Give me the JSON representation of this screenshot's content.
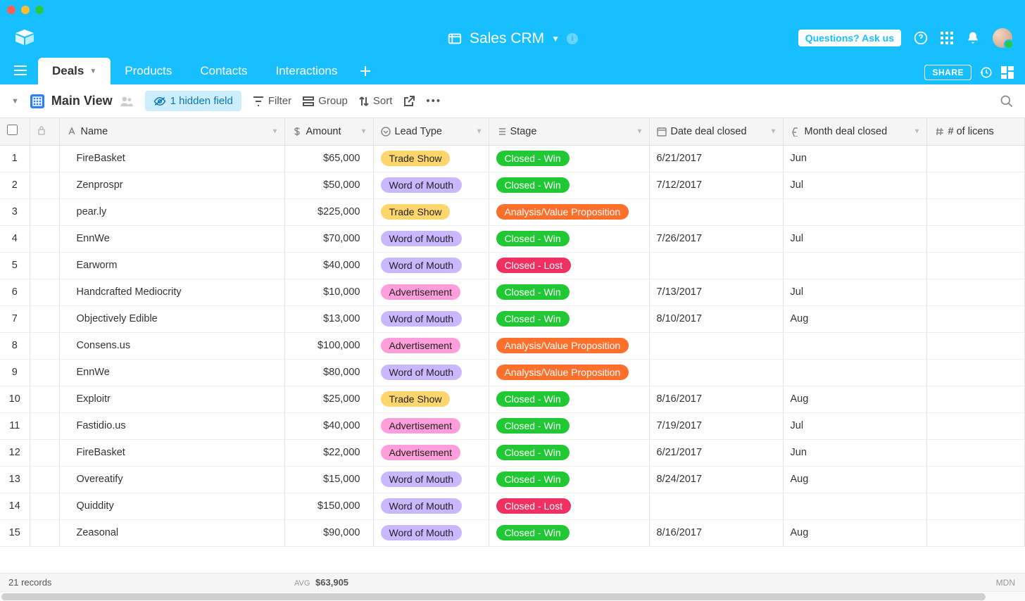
{
  "window": {
    "title": "Sales CRM"
  },
  "topbar": {
    "ask_button": "Questions? Ask us"
  },
  "tabs": [
    {
      "label": "Deals",
      "active": true
    },
    {
      "label": "Products",
      "active": false
    },
    {
      "label": "Contacts",
      "active": false
    },
    {
      "label": "Interactions",
      "active": false
    }
  ],
  "share_label": "SHARE",
  "viewbar": {
    "view_name": "Main View",
    "hidden_fields": "1 hidden field",
    "filter": "Filter",
    "group": "Group",
    "sort": "Sort"
  },
  "columns": [
    {
      "key": "name",
      "label": "Name",
      "icon": "text"
    },
    {
      "key": "amount",
      "label": "Amount",
      "icon": "currency"
    },
    {
      "key": "lead_type",
      "label": "Lead Type",
      "icon": "select"
    },
    {
      "key": "stage",
      "label": "Stage",
      "icon": "list"
    },
    {
      "key": "date_closed",
      "label": "Date deal closed",
      "icon": "date"
    },
    {
      "key": "month_closed",
      "label": "Month deal closed",
      "icon": "formula"
    },
    {
      "key": "licenses",
      "label": "# of licens",
      "icon": "number"
    }
  ],
  "lead_type_colors": {
    "Trade Show": "pill-trade-show",
    "Word of Mouth": "pill-word-of-mouth",
    "Advertisement": "pill-advertisement"
  },
  "stage_colors": {
    "Closed - Win": "pill-closed-win",
    "Closed - Lost": "pill-closed-lost",
    "Analysis/Value Proposition": "pill-analysis"
  },
  "rows": [
    {
      "name": "FireBasket",
      "amount": "$65,000",
      "lead_type": "Trade Show",
      "stage": "Closed - Win",
      "date_closed": "6/21/2017",
      "month_closed": "Jun"
    },
    {
      "name": "Zenprospr",
      "amount": "$50,000",
      "lead_type": "Word of Mouth",
      "stage": "Closed - Win",
      "date_closed": "7/12/2017",
      "month_closed": "Jul"
    },
    {
      "name": "pear.ly",
      "amount": "$225,000",
      "lead_type": "Trade Show",
      "stage": "Analysis/Value Proposition",
      "date_closed": "",
      "month_closed": ""
    },
    {
      "name": "EnnWe",
      "amount": "$70,000",
      "lead_type": "Word of Mouth",
      "stage": "Closed - Win",
      "date_closed": "7/26/2017",
      "month_closed": "Jul"
    },
    {
      "name": "Earworm",
      "amount": "$40,000",
      "lead_type": "Word of Mouth",
      "stage": "Closed - Lost",
      "date_closed": "",
      "month_closed": ""
    },
    {
      "name": "Handcrafted Mediocrity",
      "amount": "$10,000",
      "lead_type": "Advertisement",
      "stage": "Closed - Win",
      "date_closed": "7/13/2017",
      "month_closed": "Jul"
    },
    {
      "name": "Objectively Edible",
      "amount": "$13,000",
      "lead_type": "Word of Mouth",
      "stage": "Closed - Win",
      "date_closed": "8/10/2017",
      "month_closed": "Aug"
    },
    {
      "name": "Consens.us",
      "amount": "$100,000",
      "lead_type": "Advertisement",
      "stage": "Analysis/Value Proposition",
      "date_closed": "",
      "month_closed": ""
    },
    {
      "name": "EnnWe",
      "amount": "$80,000",
      "lead_type": "Word of Mouth",
      "stage": "Analysis/Value Proposition",
      "date_closed": "",
      "month_closed": ""
    },
    {
      "name": "Exploitr",
      "amount": "$25,000",
      "lead_type": "Trade Show",
      "stage": "Closed - Win",
      "date_closed": "8/16/2017",
      "month_closed": "Aug"
    },
    {
      "name": "Fastidio.us",
      "amount": "$40,000",
      "lead_type": "Advertisement",
      "stage": "Closed - Win",
      "date_closed": "7/19/2017",
      "month_closed": "Jul"
    },
    {
      "name": "FireBasket",
      "amount": "$22,000",
      "lead_type": "Advertisement",
      "stage": "Closed - Win",
      "date_closed": "6/21/2017",
      "month_closed": "Jun"
    },
    {
      "name": "Overeatify",
      "amount": "$15,000",
      "lead_type": "Word of Mouth",
      "stage": "Closed - Win",
      "date_closed": "8/24/2017",
      "month_closed": "Aug"
    },
    {
      "name": "Quiddity",
      "amount": "$150,000",
      "lead_type": "Word of Mouth",
      "stage": "Closed - Lost",
      "date_closed": "",
      "month_closed": ""
    },
    {
      "name": "Zeasonal",
      "amount": "$90,000",
      "lead_type": "Word of Mouth",
      "stage": "Closed - Win",
      "date_closed": "8/16/2017",
      "month_closed": "Aug"
    }
  ],
  "footer": {
    "record_count": "21 records",
    "avg_label": "AVG",
    "avg_value": "$63,905",
    "mdn": "MDN"
  }
}
